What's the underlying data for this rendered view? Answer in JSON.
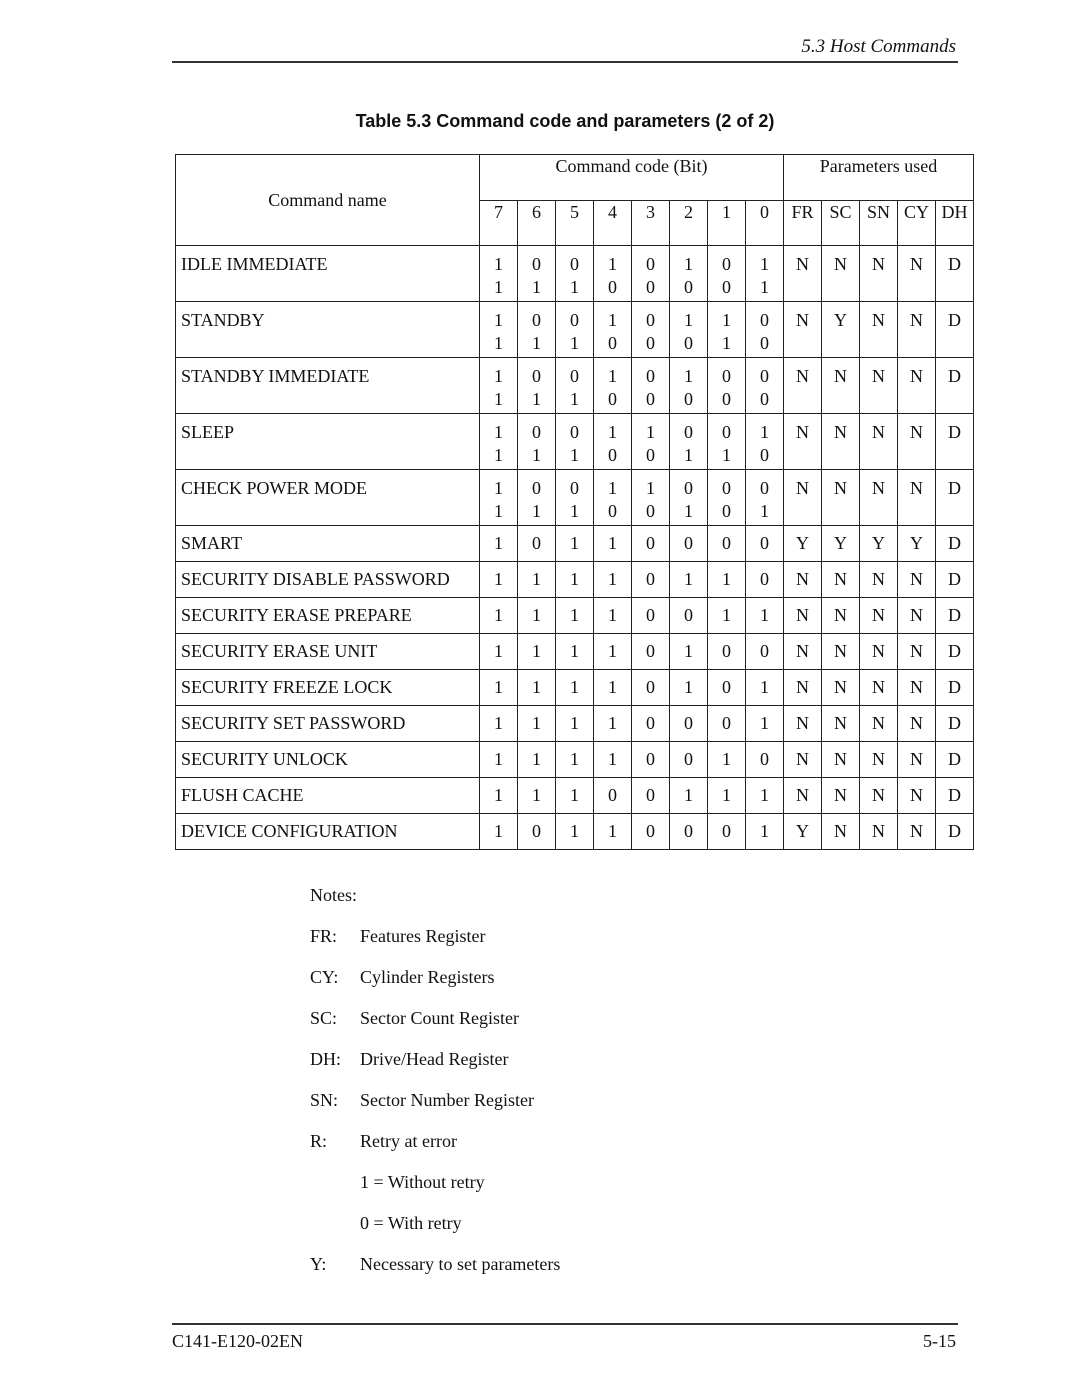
{
  "header": {
    "running_head": "5.3  Host Commands"
  },
  "table": {
    "title": "Table 5.3   Command code and parameters (2 of 2)",
    "col_command_name": "Command name",
    "col_command_code": "Command code (Bit)",
    "col_parameters": "Parameters used",
    "bits": [
      "7",
      "6",
      "5",
      "4",
      "3",
      "2",
      "1",
      "0"
    ],
    "params": [
      "FR",
      "SC",
      "SN",
      "CY",
      "DH"
    ],
    "rows": [
      {
        "name": "IDLE IMMEDIATE",
        "bits1": [
          "1",
          "0",
          "0",
          "1",
          "0",
          "1",
          "0",
          "1"
        ],
        "bits2": [
          "1",
          "1",
          "1",
          "0",
          "0",
          "0",
          "0",
          "1"
        ],
        "params": [
          "N",
          "N",
          "N",
          "N",
          "D"
        ]
      },
      {
        "name": "STANDBY",
        "bits1": [
          "1",
          "0",
          "0",
          "1",
          "0",
          "1",
          "1",
          "0"
        ],
        "bits2": [
          "1",
          "1",
          "1",
          "0",
          "0",
          "0",
          "1",
          "0"
        ],
        "params": [
          "N",
          "Y",
          "N",
          "N",
          "D"
        ]
      },
      {
        "name": "STANDBY IMMEDIATE",
        "bits1": [
          "1",
          "0",
          "0",
          "1",
          "0",
          "1",
          "0",
          "0"
        ],
        "bits2": [
          "1",
          "1",
          "1",
          "0",
          "0",
          "0",
          "0",
          "0"
        ],
        "params": [
          "N",
          "N",
          "N",
          "N",
          "D"
        ]
      },
      {
        "name": "SLEEP",
        "bits1": [
          "1",
          "0",
          "0",
          "1",
          "1",
          "0",
          "0",
          "1"
        ],
        "bits2": [
          "1",
          "1",
          "1",
          "0",
          "0",
          "1",
          "1",
          "0"
        ],
        "params": [
          "N",
          "N",
          "N",
          "N",
          "D"
        ]
      },
      {
        "name": "CHECK POWER MODE",
        "bits1": [
          "1",
          "0",
          "0",
          "1",
          "1",
          "0",
          "0",
          "0"
        ],
        "bits2": [
          "1",
          "1",
          "1",
          "0",
          "0",
          "1",
          "0",
          "1"
        ],
        "params": [
          "N",
          "N",
          "N",
          "N",
          "D"
        ]
      },
      {
        "name": "SMART",
        "bits1": [
          "1",
          "0",
          "1",
          "1",
          "0",
          "0",
          "0",
          "0"
        ],
        "params": [
          "Y",
          "Y",
          "Y",
          "Y",
          "D"
        ]
      },
      {
        "name": "SECURITY DISABLE PASSWORD",
        "bits1": [
          "1",
          "1",
          "1",
          "1",
          "0",
          "1",
          "1",
          "0"
        ],
        "params": [
          "N",
          "N",
          "N",
          "N",
          "D"
        ]
      },
      {
        "name": "SECURITY ERASE PREPARE",
        "bits1": [
          "1",
          "1",
          "1",
          "1",
          "0",
          "0",
          "1",
          "1"
        ],
        "params": [
          "N",
          "N",
          "N",
          "N",
          "D"
        ]
      },
      {
        "name": "SECURITY ERASE UNIT",
        "bits1": [
          "1",
          "1",
          "1",
          "1",
          "0",
          "1",
          "0",
          "0"
        ],
        "params": [
          "N",
          "N",
          "N",
          "N",
          "D"
        ]
      },
      {
        "name": "SECURITY FREEZE LOCK",
        "bits1": [
          "1",
          "1",
          "1",
          "1",
          "0",
          "1",
          "0",
          "1"
        ],
        "params": [
          "N",
          "N",
          "N",
          "N",
          "D"
        ]
      },
      {
        "name": "SECURITY SET PASSWORD",
        "bits1": [
          "1",
          "1",
          "1",
          "1",
          "0",
          "0",
          "0",
          "1"
        ],
        "params": [
          "N",
          "N",
          "N",
          "N",
          "D"
        ]
      },
      {
        "name": "SECURITY UNLOCK",
        "bits1": [
          "1",
          "1",
          "1",
          "1",
          "0",
          "0",
          "1",
          "0"
        ],
        "params": [
          "N",
          "N",
          "N",
          "N",
          "D"
        ]
      },
      {
        "name": "FLUSH CACHE",
        "bits1": [
          "1",
          "1",
          "1",
          "0",
          "0",
          "1",
          "1",
          "1"
        ],
        "params": [
          "N",
          "N",
          "N",
          "N",
          "D"
        ]
      },
      {
        "name": "DEVICE CONFIGURATION",
        "bits1": [
          "1",
          "0",
          "1",
          "1",
          "0",
          "0",
          "0",
          "1"
        ],
        "params": [
          "Y",
          "N",
          "N",
          "N",
          "D"
        ]
      }
    ]
  },
  "notes": {
    "title": "Notes:",
    "items": [
      {
        "key": "FR:",
        "text": "Features Register"
      },
      {
        "key": "CY:",
        "text": "Cylinder Registers"
      },
      {
        "key": "SC:",
        "text": "Sector Count Register"
      },
      {
        "key": "DH:",
        "text": "Drive/Head Register"
      },
      {
        "key": "SN:",
        "text": "Sector Number Register"
      },
      {
        "key": "R:",
        "text": "Retry at error"
      }
    ],
    "sub_items": [
      "1 =  Without retry",
      "0 =  With retry"
    ],
    "final": {
      "key": "Y:",
      "text": "Necessary to set parameters"
    }
  },
  "footer": {
    "doc_id": "C141-E120-02EN",
    "page_number": "5-15"
  }
}
